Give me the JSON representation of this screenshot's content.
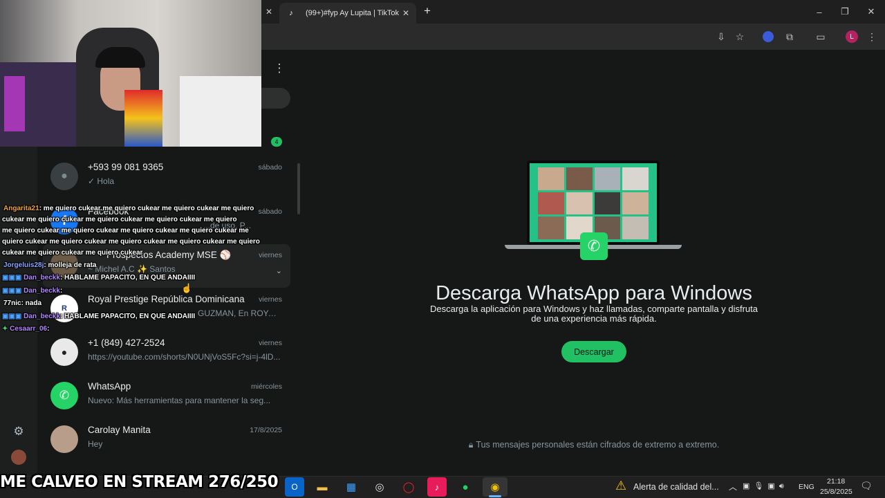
{
  "browser": {
    "tab_title": "(99+)#fyp Ay Lupita | TikTok",
    "new_tab": "+",
    "profile_initial": "L"
  },
  "whatsapp": {
    "unread_badge": "4",
    "chats": [
      {
        "name": "+593 99 081 9365",
        "date": "sábado",
        "preview": "✓ Hola"
      },
      {
        "name": "Facebook",
        "date": "sábado",
        "preview": "...de uso. P..."
      },
      {
        "name": "Prospectos Academy MSE ⚾",
        "date": "viernes",
        "preview": "~ Michel A.C ✨ Santos"
      },
      {
        "name": "Royal Prestige República Dominicana",
        "date": "viernes",
        "preview": "GUZMAN, En ROYAL ..."
      },
      {
        "name": "+1 (849) 427-2524",
        "date": "viernes",
        "preview": "https://youtube.com/shorts/N0UNjVoS5Fc?si=j-4lD..."
      },
      {
        "name": "WhatsApp",
        "date": "miércoles",
        "preview": "Nuevo: Más herramientas para mantener la seg..."
      },
      {
        "name": "Carolay Manita",
        "date": "17/8/2025",
        "preview": "Hey"
      }
    ],
    "hero_title": "Descarga WhatsApp para Windows",
    "hero_subtitle": "Descarga la aplicación para Windows y haz llamadas, comparte pantalla y disfruta de una experiencia más rápida.",
    "download_button": "Descargar",
    "encryption_note": "Tus mensajes personales están cifrados de extremo a extremo."
  },
  "stream_chat": [
    {
      "user": "Angarita21",
      "text": ": me quiero cukear me quiero cukear me quiero cukear me quiero"
    },
    {
      "user": "",
      "text": "cukear me quiero cukear me quiero cukear me quiero cukear me quiero"
    },
    {
      "user": "",
      "text": "me quiero cukear me quiero cukear me quiero cukear me quiero cukear me"
    },
    {
      "user": "",
      "text": "quiero cukear me quiero cukear me quiero cukear me quiero cukear me quiero"
    },
    {
      "user": "",
      "text": "cukear me quiero cukear me quiero cukear"
    },
    {
      "user": "Jorgeluis28j",
      "text": ": molleja de rata"
    },
    {
      "user": "Dan_beckk",
      "text": ": HABLAME PAPACITO, EN QUE ANDAIIII"
    },
    {
      "user": "Dan_beckk",
      "text": ":"
    },
    {
      "user": "77nic",
      "text": ": nada"
    },
    {
      "user": "Dan_beckk",
      "text": ": HABLAME PAPACITO, EN QUE ANDAIIII"
    },
    {
      "user": "Cesaarr_06",
      "text": ":"
    }
  ],
  "stream_banner": "ME CALVEO EN STREAM 276/250",
  "taskbar": {
    "weather_alert": "Alerta de calidad del...",
    "language": "ENG",
    "time": "21:18",
    "date": "25/8/2025"
  }
}
